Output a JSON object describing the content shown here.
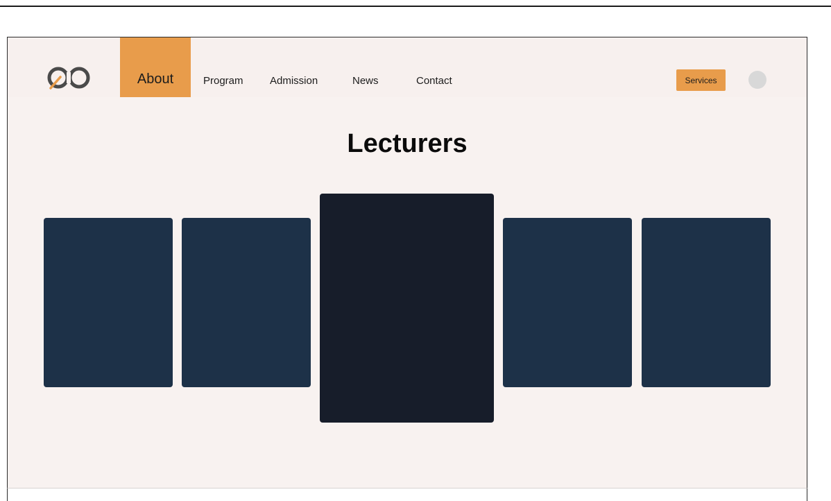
{
  "nav": {
    "items": [
      {
        "label": "About",
        "active": true
      },
      {
        "label": "Program"
      },
      {
        "label": "Admission"
      },
      {
        "label": "News"
      },
      {
        "label": "Contact"
      }
    ],
    "services_label": "Services"
  },
  "main": {
    "title": "Lecturers",
    "cards": [
      {
        "featured": false
      },
      {
        "featured": false
      },
      {
        "featured": true
      },
      {
        "featured": false
      },
      {
        "featured": false
      }
    ]
  },
  "colors": {
    "accent": "#e89c4b",
    "page_bg": "#f8f2f0",
    "card": "#1d3148",
    "card_featured": "#171d2a",
    "logo": "#4a4a4a"
  }
}
